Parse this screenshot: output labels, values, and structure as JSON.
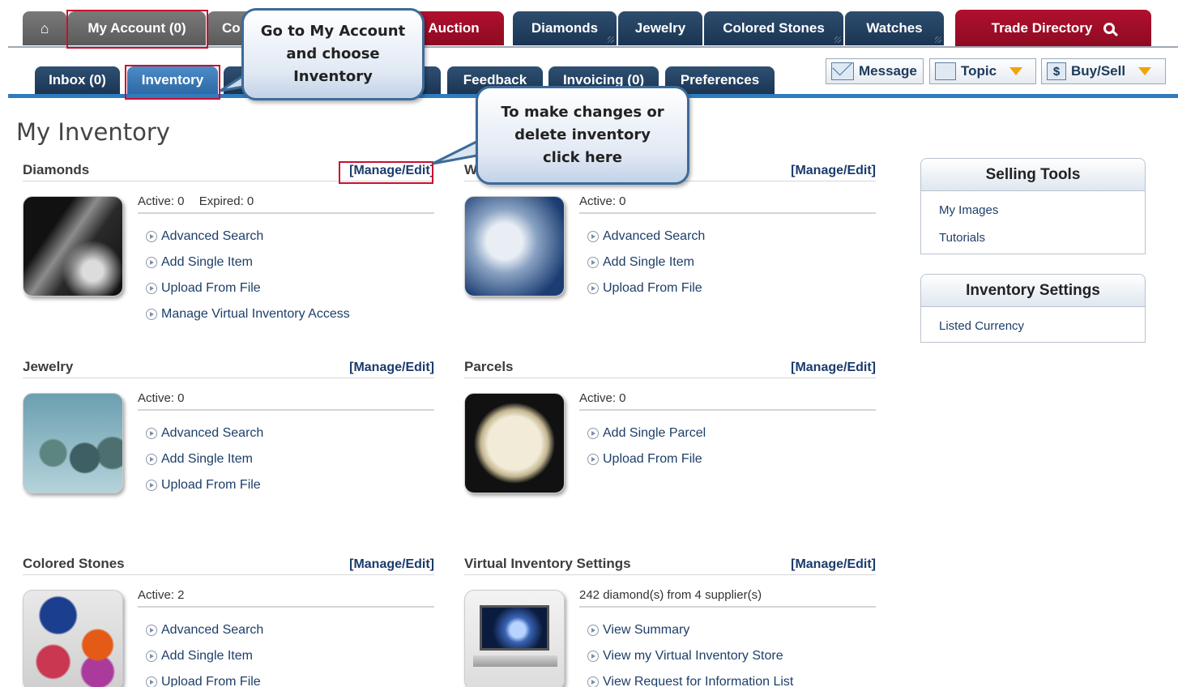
{
  "topnav": {
    "home_label": "",
    "my_account": "My Account (0)",
    "co_partial": "Co",
    "auction": "Auction",
    "diamonds": "Diamonds",
    "jewelry": "Jewelry",
    "colored_stones": "Colored Stones",
    "watches": "Watches",
    "trade_directory": "Trade Directory"
  },
  "subtabs": {
    "inbox": "Inbox (0)",
    "inventory": "Inventory",
    "feedback": "Feedback",
    "invoicing": "Invoicing (0)",
    "preferences": "Preferences"
  },
  "tools": {
    "message": "Message",
    "topic": "Topic",
    "buy_sell": "Buy/Sell"
  },
  "callouts": {
    "account": [
      "Go to My Account",
      "and choose",
      "Inventory"
    ],
    "manage": [
      "To make changes or",
      "delete inventory",
      "click here"
    ]
  },
  "page_title": "My Inventory",
  "manage_label": "[Manage/Edit]",
  "sections": {
    "diamonds": {
      "title": "Diamonds",
      "active": "Active: 0",
      "expired": "Expired: 0",
      "links": [
        "Advanced Search",
        "Add Single Item",
        "Upload From File",
        "Manage Virtual Inventory Access"
      ]
    },
    "watches": {
      "title": "W",
      "active": "Active: 0",
      "links": [
        "Advanced Search",
        "Add Single Item",
        "Upload From File"
      ]
    },
    "jewelry": {
      "title": "Jewelry",
      "active": "Active: 0",
      "links": [
        "Advanced Search",
        "Add Single Item",
        "Upload From File"
      ]
    },
    "parcels": {
      "title": "Parcels",
      "active": "Active: 0",
      "links": [
        "Add Single Parcel",
        "Upload From File"
      ]
    },
    "colored_stones": {
      "title": "Colored Stones",
      "active": "Active: 2",
      "links": [
        "Advanced Search",
        "Add Single Item",
        "Upload From File"
      ]
    },
    "virtual": {
      "title": "Virtual Inventory Settings",
      "active": "242 diamond(s) from 4 supplier(s)",
      "links": [
        "View Summary",
        "View my Virtual Inventory Store",
        "View Request for Information List"
      ]
    }
  },
  "sidebar": {
    "selling_tools": {
      "title": "Selling Tools",
      "links": [
        "My Images",
        "Tutorials"
      ]
    },
    "inventory_settings": {
      "title": "Inventory Settings",
      "links": [
        "Listed Currency"
      ]
    }
  },
  "colors": {
    "nav_navy": "#1b3553",
    "nav_red": "#a00d28",
    "active_blue": "#2d6aa6",
    "highlight_red": "#c8102e",
    "link_blue": "#1d3e69"
  }
}
